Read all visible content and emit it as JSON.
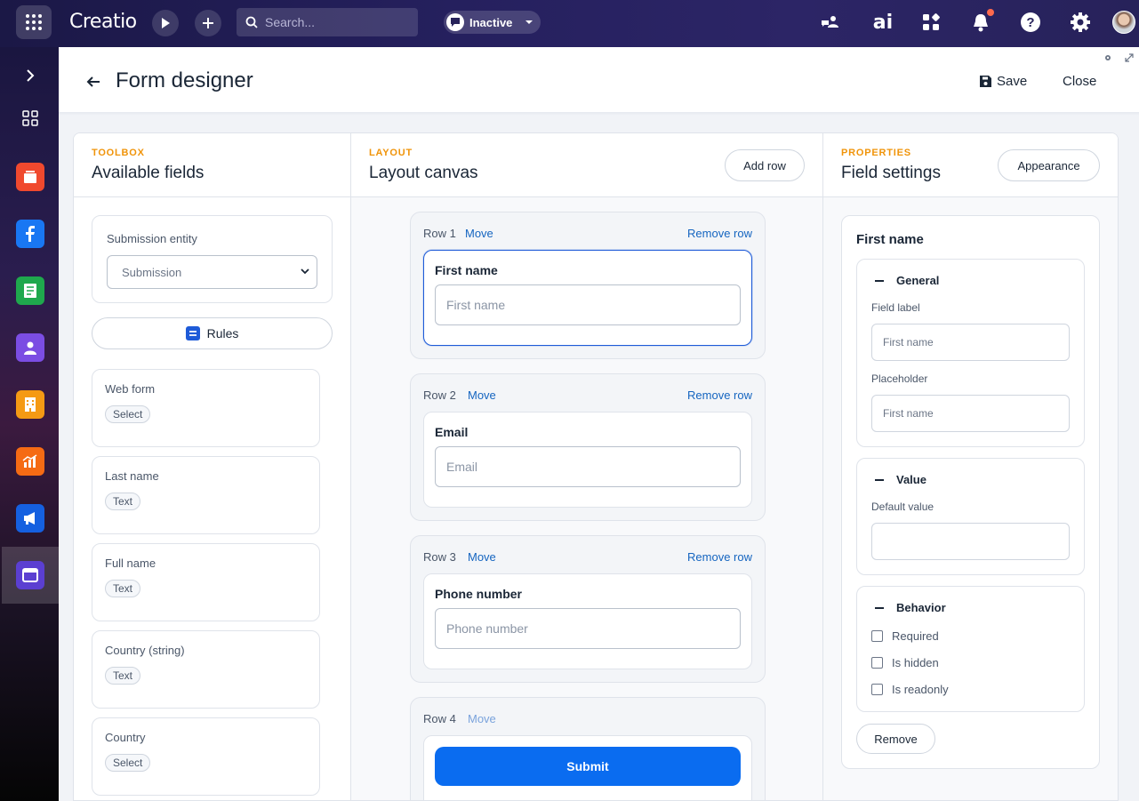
{
  "topbar": {
    "logo": "Creatio",
    "search_placeholder": "Search...",
    "status": "Inactive",
    "ai_label": "ai"
  },
  "header": {
    "title": "Form designer",
    "save": "Save",
    "close": "Close"
  },
  "toolbox": {
    "eyebrow": "TOOLBOX",
    "title": "Available fields",
    "entity_label": "Submission entity",
    "entity_value": "Submission",
    "rules": "Rules",
    "fields": [
      {
        "name": "Web form",
        "type": "Select"
      },
      {
        "name": "Last name",
        "type": "Text"
      },
      {
        "name": "Full name",
        "type": "Text"
      },
      {
        "name": "Country (string)",
        "type": "Text"
      },
      {
        "name": "Country",
        "type": "Select"
      }
    ]
  },
  "layout": {
    "eyebrow": "LAYOUT",
    "title": "Layout canvas",
    "add_row": "Add row",
    "move": "Move",
    "remove_row": "Remove row",
    "rows": [
      {
        "label": "Row 1",
        "field": "First name",
        "placeholder": "First name"
      },
      {
        "label": "Row 2",
        "field": "Email",
        "placeholder": "Email"
      },
      {
        "label": "Row 3",
        "field": "Phone number",
        "placeholder": "Phone number"
      },
      {
        "label": "Row 4",
        "button": "Submit"
      }
    ]
  },
  "properties": {
    "eyebrow": "PROPERTIES",
    "title": "Field settings",
    "appearance": "Appearance",
    "selected_field": "First name",
    "general": {
      "title": "General",
      "field_label": "Field label",
      "field_label_placeholder": "First name",
      "placeholder_label": "Placeholder",
      "placeholder_placeholder": "First name"
    },
    "value": {
      "title": "Value",
      "default_label": "Default value",
      "default_value": ""
    },
    "behavior": {
      "title": "Behavior",
      "options": [
        "Required",
        "Is hidden",
        "Is readonly"
      ]
    },
    "remove": "Remove"
  },
  "colors": {
    "accent": "#0a6cf0",
    "link": "#1565c0",
    "eyebrow": "#f0940a"
  }
}
